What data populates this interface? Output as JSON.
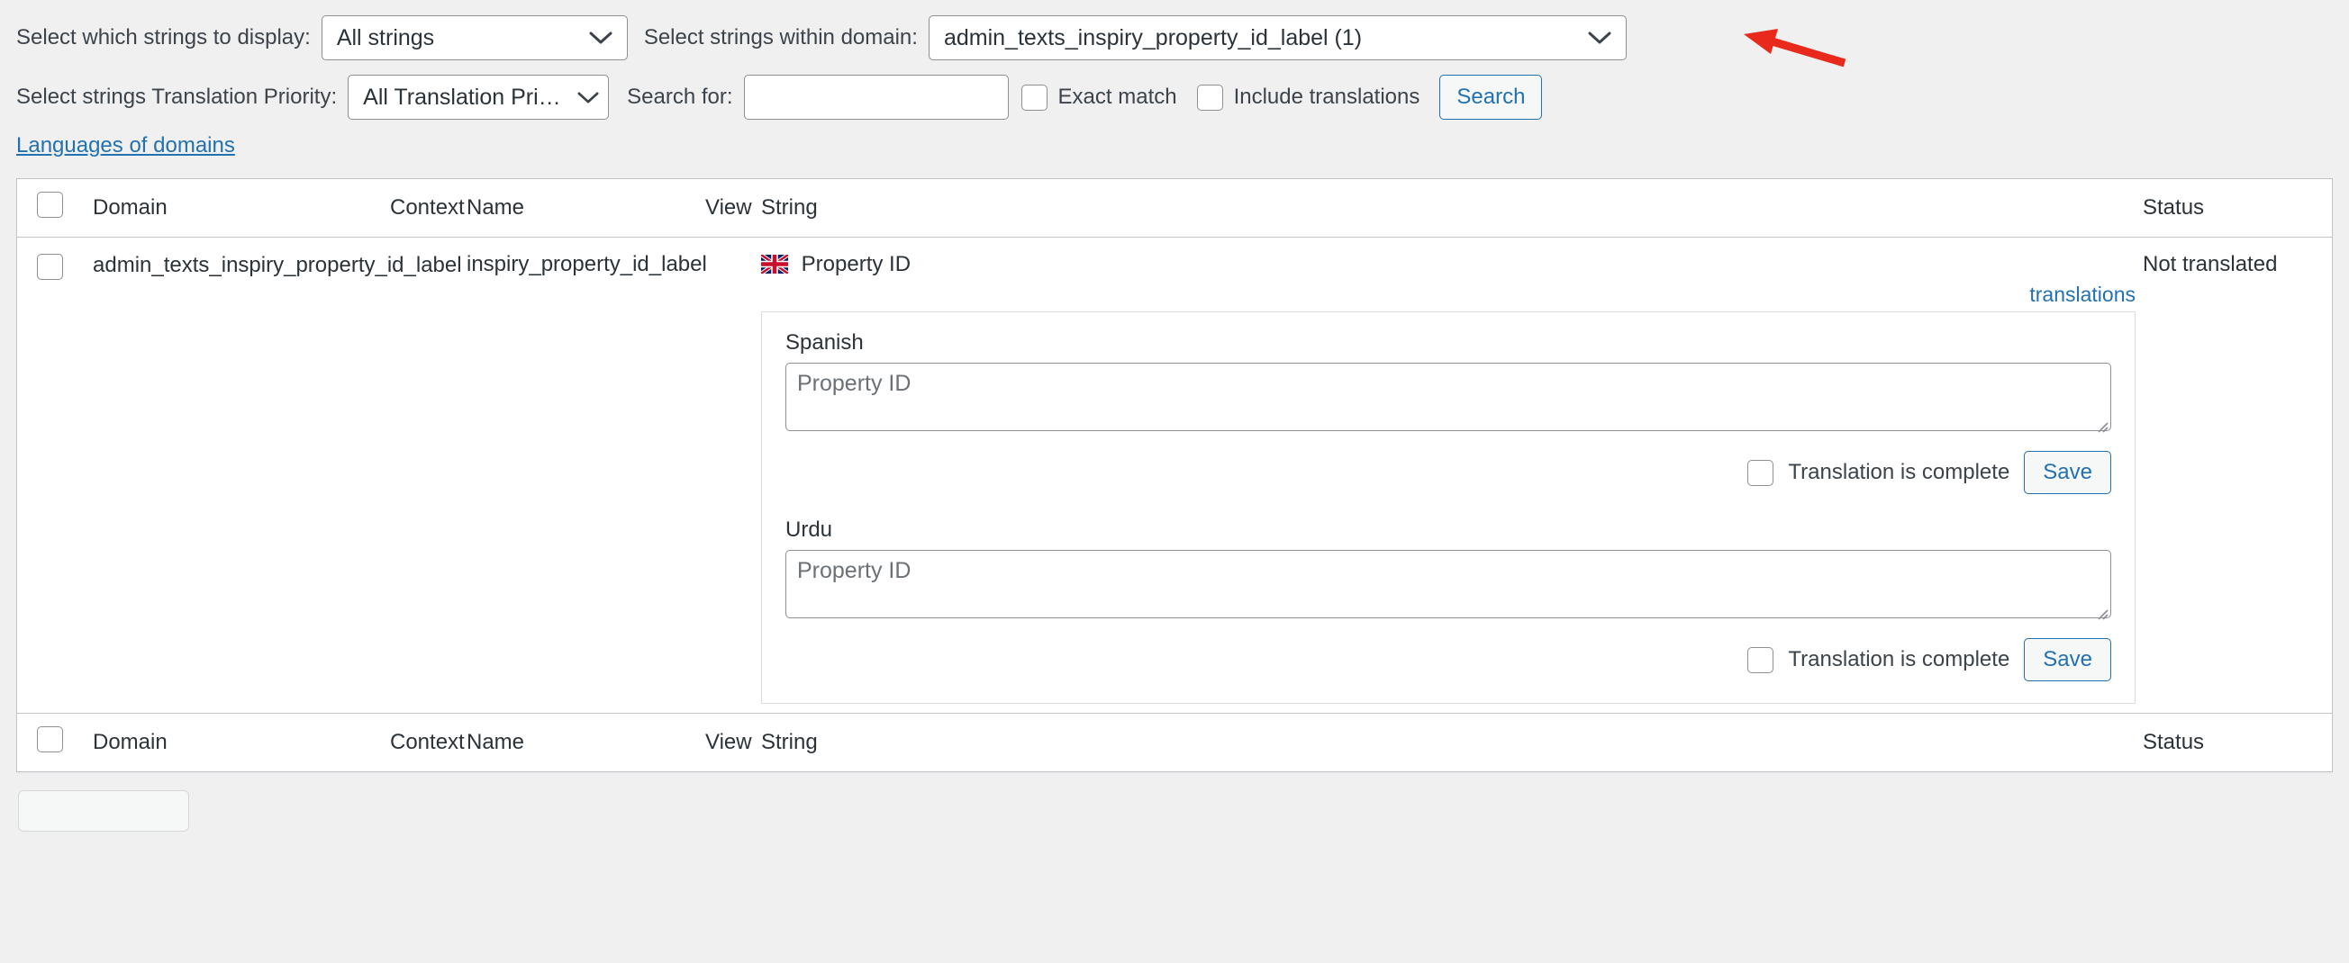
{
  "filters": {
    "display_label": "Select which strings to display:",
    "display_value": "All strings",
    "domain_label": "Select strings within domain:",
    "domain_value": "admin_texts_inspiry_property_id_label (1)",
    "priority_label": "Select strings Translation Priority:",
    "priority_value": "All Translation Priorities",
    "search_label": "Search for:",
    "search_value": "",
    "search_placeholder": "",
    "exact_match_label": "Exact match",
    "include_translations_label": "Include translations",
    "search_button": "Search"
  },
  "links": {
    "languages_of_domains": "Languages of domains"
  },
  "table": {
    "columns": {
      "domain": "Domain",
      "context": "Context",
      "name": "Name",
      "view": "View",
      "string": "String",
      "status": "Status"
    },
    "rows": [
      {
        "domain": "admin_texts_inspiry_property_id_label",
        "context": "",
        "name": "inspiry_property_id_label",
        "view": "",
        "string": "Property ID",
        "string_flag": "uk-flag-icon",
        "status": "Not translated",
        "translations_link": "translations",
        "translations": [
          {
            "language": "Spanish",
            "value": "",
            "placeholder": "Property ID",
            "complete_label": "Translation is complete",
            "complete_checked": false,
            "save_label": "Save"
          },
          {
            "language": "Urdu",
            "value": "",
            "placeholder": "Property ID",
            "complete_label": "Translation is complete",
            "complete_checked": false,
            "save_label": "Save"
          }
        ]
      }
    ]
  },
  "colors": {
    "page_bg": "#f0f0f1",
    "accent_blue": "#2271b1",
    "text": "#2c3338",
    "border": "#8c8f94",
    "annotation_red": "#e8291c"
  }
}
